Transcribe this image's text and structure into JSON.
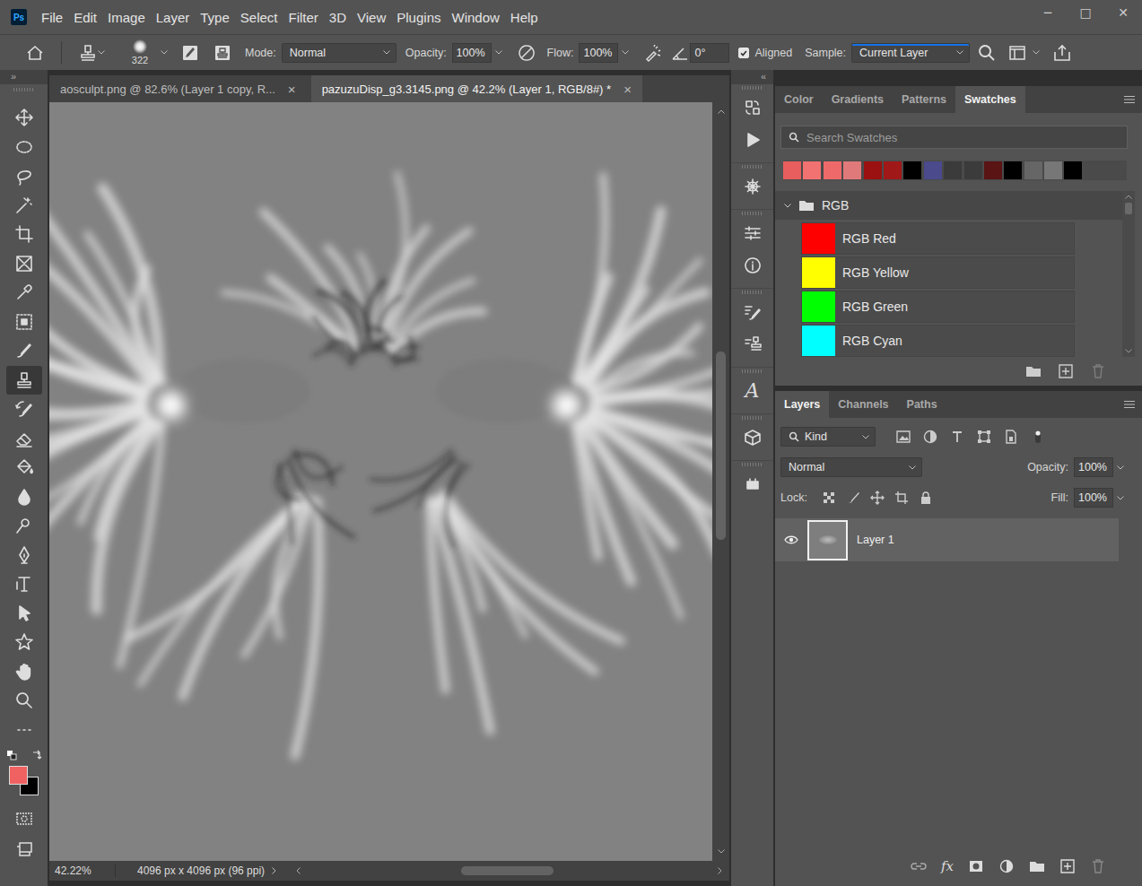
{
  "app": {
    "logo": "Ps"
  },
  "menu": [
    "File",
    "Edit",
    "Image",
    "Layer",
    "Type",
    "Select",
    "Filter",
    "3D",
    "View",
    "Plugins",
    "Window",
    "Help"
  ],
  "window_controls": [
    "─",
    "□",
    "✕"
  ],
  "options_bar": {
    "brush_size": "322",
    "mode_label": "Mode:",
    "mode": "Normal",
    "opacity_label": "Opacity:",
    "opacity": "100%",
    "flow_label": "Flow:",
    "flow": "100%",
    "angle": "0°",
    "aligned": {
      "label": "Aligned",
      "checked": true
    },
    "sample_label": "Sample:",
    "sample": "Current Layer"
  },
  "panel_toggles": {
    "left": "»",
    "right": "«"
  },
  "panel_dock": {
    "character_glyph": "A"
  },
  "toolbar": {
    "tools": [
      {
        "kind": "move",
        "selected": false
      },
      {
        "kind": "marquee",
        "selected": false
      },
      {
        "kind": "lasso",
        "selected": false
      },
      {
        "kind": "wand",
        "selected": false
      },
      {
        "kind": "crop",
        "selected": false
      },
      {
        "kind": "frame",
        "selected": false
      },
      {
        "kind": "eyedropper",
        "selected": false
      },
      {
        "kind": "healing",
        "selected": false
      },
      {
        "kind": "brush",
        "selected": false
      },
      {
        "kind": "stamp",
        "selected": true
      },
      {
        "kind": "history",
        "selected": false
      },
      {
        "kind": "eraser",
        "selected": false
      },
      {
        "kind": "bucket",
        "selected": false
      },
      {
        "kind": "blur",
        "selected": false
      },
      {
        "kind": "dodge",
        "selected": false
      },
      {
        "kind": "pen",
        "selected": false
      },
      {
        "kind": "type",
        "selected": false
      },
      {
        "kind": "pathselect",
        "selected": false
      },
      {
        "kind": "shape",
        "selected": false
      },
      {
        "kind": "hand",
        "selected": false
      },
      {
        "kind": "zoom",
        "selected": false
      },
      {
        "kind": "more",
        "selected": false
      }
    ],
    "foreground": "#f06262",
    "background": "#000000"
  },
  "document": {
    "tabs": [
      {
        "label": "aosculpt.png @ 82.6% (Layer 1 copy, R...",
        "selected": false,
        "close": "×"
      },
      {
        "label": "pazuzuDisp_g3.3145.png @ 42.2% (Layer 1, RGB/8#) *",
        "selected": true,
        "close": "×"
      }
    ],
    "vertical_scroll": {
      "position": 0.32,
      "size": 0.26
    },
    "horizontal_scroll": {
      "position": 0.38,
      "size": 0.23
    }
  },
  "status_bar": {
    "zoom": "42.22%",
    "info": "4096 px x 4096 px (96 ppi)"
  },
  "swatches_panel": {
    "tabs": [
      {
        "label": "Color",
        "selected": false
      },
      {
        "label": "Gradients",
        "selected": false
      },
      {
        "label": "Patterns",
        "selected": false
      },
      {
        "label": "Swatches",
        "selected": true
      }
    ],
    "search_placeholder": "Search Swatches",
    "recent": [
      "#e85d5d",
      "#f27272",
      "#ee6a6a",
      "#e07a7a",
      "#9b1010",
      "#a01818",
      "#000000",
      "#4a4a8c",
      "#3b3b3b",
      "#3b3b3b",
      "#5a1414",
      "#000000",
      "#666666",
      "#777777",
      "#000000"
    ],
    "groups": [
      {
        "name": "RGB",
        "expanded": true,
        "items": [
          {
            "name": "RGB Red",
            "color": "#ff0000"
          },
          {
            "name": "RGB Yellow",
            "color": "#ffff00"
          },
          {
            "name": "RGB Green",
            "color": "#00ff00"
          },
          {
            "name": "RGB Cyan",
            "color": "#00ffff"
          }
        ]
      }
    ],
    "list_scroll": {
      "position": 0,
      "size": 0.08
    }
  },
  "layers_panel": {
    "tabs": [
      {
        "label": "Layers",
        "selected": true
      },
      {
        "label": "Channels",
        "selected": false
      },
      {
        "label": "Paths",
        "selected": false
      }
    ],
    "filter": "Kind",
    "blend_mode": "Normal",
    "opacity_label": "Opacity:",
    "opacity": "100%",
    "lock_label": "Lock:",
    "fill_label": "Fill:",
    "fill": "100%",
    "layers": [
      {
        "name": "Layer 1",
        "visible": true,
        "selected": true
      }
    ],
    "footer_fx": "fx"
  }
}
